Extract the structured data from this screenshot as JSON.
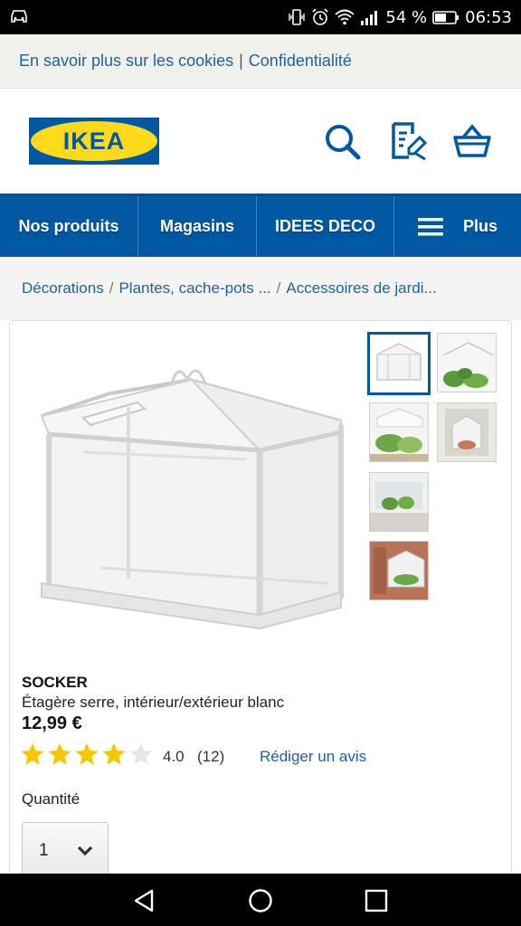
{
  "status": {
    "battery": "54 %",
    "time": "06:53",
    "icons": [
      "car-icon",
      "vibrate-icon",
      "alarm-icon",
      "wifi-icon",
      "signal-icon",
      "battery-icon"
    ]
  },
  "cookie_bar": {
    "learn_more": "En savoir plus sur les cookies",
    "separator": "|",
    "privacy": "Confidentialité"
  },
  "header": {
    "logo_text": "IKEA",
    "registered": "®",
    "icons": [
      "search-icon",
      "shopping-list-icon",
      "basket-icon"
    ]
  },
  "nav": {
    "items": [
      {
        "label": "Nos produits"
      },
      {
        "label": "Magasins"
      },
      {
        "label": "IDEES DECO"
      },
      {
        "label": "Plus"
      }
    ]
  },
  "breadcrumb": {
    "items": [
      "Décorations",
      "Plantes, cache-pots ...",
      "Accessoires de jardi..."
    ],
    "separator": "/"
  },
  "product": {
    "name": "SOCKER",
    "description": "Étagère serre, intérieur/extérieur blanc",
    "price": "12,99 €",
    "rating_value": "4.0",
    "rating_count": "(12)",
    "stars_filled": 4,
    "stars_total": 5,
    "review_link": "Rédiger un avis",
    "quantity_label": "Quantité",
    "quantity_value": "1"
  },
  "colors": {
    "brand_blue": "#0058a3",
    "brand_yellow": "#ffda1a",
    "link_blue": "#1b62a8",
    "star_yellow": "#f6c600"
  }
}
